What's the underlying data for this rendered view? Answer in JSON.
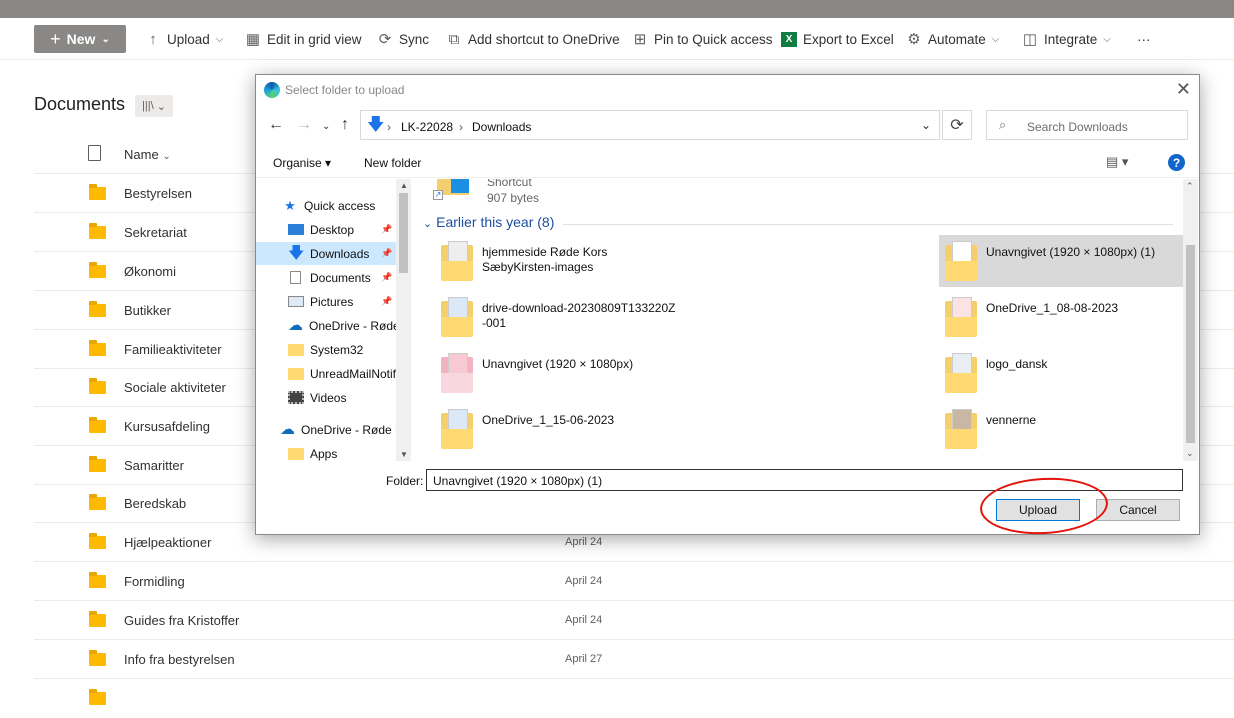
{
  "command_bar": {
    "new_label": "New",
    "items": [
      {
        "label": "Upload",
        "icon": "upload-arrow-icon",
        "dropdown": true
      },
      {
        "label": "Edit in grid view",
        "icon": "grid-icon",
        "dropdown": false
      },
      {
        "label": "Sync",
        "icon": "sync-icon",
        "dropdown": false
      },
      {
        "label": "Add shortcut to OneDrive",
        "icon": "shortcut-icon",
        "dropdown": false
      },
      {
        "label": "Pin to Quick access",
        "icon": "pin-icon",
        "dropdown": false
      },
      {
        "label": "Export to Excel",
        "icon": "excel-icon",
        "dropdown": false
      },
      {
        "label": "Automate",
        "icon": "automate-icon",
        "dropdown": true
      },
      {
        "label": "Integrate",
        "icon": "integrate-icon",
        "dropdown": true
      }
    ],
    "more_label": "···"
  },
  "library": {
    "title": "Documents",
    "name_column": "Name",
    "rows": [
      {
        "name": "Bestyrelsen",
        "date": ""
      },
      {
        "name": "Sekretariat",
        "date": ""
      },
      {
        "name": "Økonomi",
        "date": ""
      },
      {
        "name": "Butikker",
        "date": ""
      },
      {
        "name": "Familieaktiviteter",
        "date": ""
      },
      {
        "name": "Sociale aktiviteter",
        "date": ""
      },
      {
        "name": "Kursusafdeling",
        "date": ""
      },
      {
        "name": "Samaritter",
        "date": ""
      },
      {
        "name": "Beredskab",
        "date": ""
      },
      {
        "name": "Hjælpeaktioner",
        "date": "April 24"
      },
      {
        "name": "Formidling",
        "date": "April 24"
      },
      {
        "name": "Guides fra Kristoffer",
        "date": "April 24"
      },
      {
        "name": "Info fra bestyrelsen",
        "date": "April 27"
      }
    ]
  },
  "dialog": {
    "title": "Select folder to upload",
    "address": {
      "crumbs": [
        "LK-22028",
        "Downloads"
      ]
    },
    "search_placeholder": "Search Downloads",
    "organise_label": "Organise ▾",
    "new_folder_label": "New folder",
    "nav_items": [
      {
        "label": "Quick access",
        "icon": "star-icon",
        "pinned": false,
        "selected": false,
        "indent": 1
      },
      {
        "label": "Desktop",
        "icon": "desktop-icon",
        "pinned": true,
        "selected": false,
        "indent": 2
      },
      {
        "label": "Downloads",
        "icon": "download-icon",
        "pinned": true,
        "selected": true,
        "indent": 2
      },
      {
        "label": "Documents",
        "icon": "document-icon",
        "pinned": true,
        "selected": false,
        "indent": 2
      },
      {
        "label": "Pictures",
        "icon": "pictures-icon",
        "pinned": true,
        "selected": false,
        "indent": 2
      },
      {
        "label": "OneDrive - Røde",
        "icon": "cloud-icon",
        "pinned": false,
        "selected": false,
        "indent": 2
      },
      {
        "label": "System32",
        "icon": "folder-icon",
        "pinned": false,
        "selected": false,
        "indent": 2
      },
      {
        "label": "UnreadMailNotif",
        "icon": "folder-icon",
        "pinned": false,
        "selected": false,
        "indent": 2
      },
      {
        "label": "Videos",
        "icon": "video-icon",
        "pinned": false,
        "selected": false,
        "indent": 2
      },
      {
        "label": "OneDrive - Røde K",
        "icon": "cloud-icon",
        "pinned": false,
        "selected": false,
        "indent": 1
      },
      {
        "label": "Apps",
        "icon": "folder-icon",
        "pinned": false,
        "selected": false,
        "indent": 2
      }
    ],
    "shortcut_item": {
      "name": "Shortcut",
      "size": "907 bytes"
    },
    "group_label": "Earlier this year (8)",
    "files": [
      {
        "name": "hjemmeside Røde Kors\nSæbyKirsten-images",
        "selected": false
      },
      {
        "name": "Unavngivet (1920 × 1080px) (1)",
        "selected": true
      },
      {
        "name": "drive-download-20230809T133220Z\n-001",
        "selected": false
      },
      {
        "name": "OneDrive_1_08-08-2023",
        "selected": false
      },
      {
        "name": "Unavngivet (1920 × 1080px)",
        "selected": false
      },
      {
        "name": "logo_dansk",
        "selected": false
      },
      {
        "name": "OneDrive_1_15-06-2023",
        "selected": false
      },
      {
        "name": "vennerne",
        "selected": false
      }
    ],
    "folder_label": "Folder:",
    "folder_value": "Unavngivet (1920 × 1080px) (1)",
    "upload_label": "Upload",
    "cancel_label": "Cancel"
  },
  "colors": {
    "accent": "#0078d7",
    "annotation": "#e3120b",
    "folder": "#ffb900"
  }
}
